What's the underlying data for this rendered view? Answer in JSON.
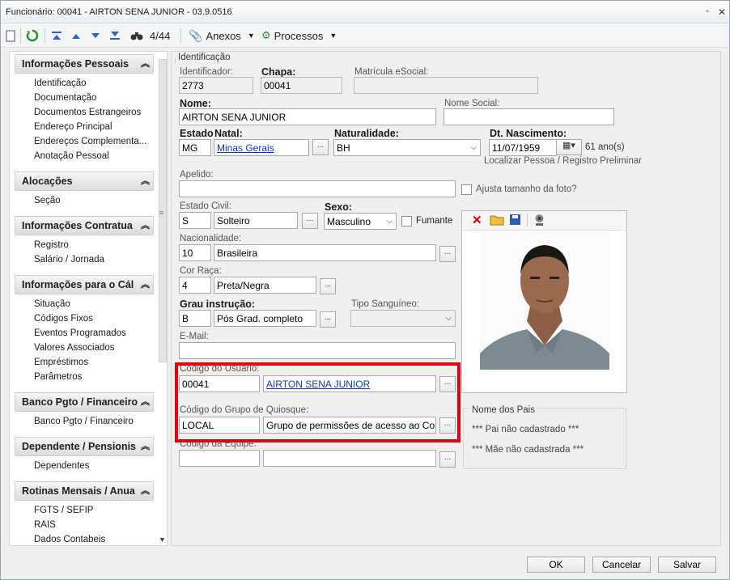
{
  "window": {
    "title": "Funcionário: 00041 - AIRTON SENA JUNIOR - 03.9.0516"
  },
  "toolbar": {
    "record": "4/44",
    "anexos": "Anexos",
    "processos": "Processos"
  },
  "sidebar": {
    "groups": [
      {
        "title": "Informações Pessoais",
        "items": [
          "Identificação",
          "Documentação",
          "Documentos Estrangeiros",
          "Endereço Principal",
          "Endereços Complementa...",
          "Anotação Pessoal"
        ]
      },
      {
        "title": "Alocações",
        "items": [
          "Seção"
        ]
      },
      {
        "title": "Informações Contratua",
        "items": [
          "Registro",
          "Salário / Jornada"
        ]
      },
      {
        "title": "Informações para o Cál",
        "items": [
          "Situação",
          "Códigos Fixos",
          "Eventos Programados",
          "Valores Associados",
          "Empréstimos",
          "Parâmetros"
        ]
      },
      {
        "title": "Banco Pgto / Financeiro",
        "items": [
          "Banco Pgto / Financeiro"
        ]
      },
      {
        "title": "Dependente / Pensionis",
        "items": [
          "Dependentes"
        ]
      },
      {
        "title": "Rotinas Mensais / Anua",
        "items": [
          "FGTS / SEFIP",
          "RAIS",
          "Dados Contabeis"
        ]
      }
    ]
  },
  "form": {
    "section": "Identificação",
    "identificador_label": "Identificador:",
    "identificador": "2773",
    "chapa_label": "Chapa:",
    "chapa": "00041",
    "matricula_label": "Matrícula eSocial:",
    "matricula": "",
    "nome_label": "Nome:",
    "nome": "AIRTON SENA JUNIOR",
    "nome_social_label": "Nome Social:",
    "nome_social": "",
    "estado_label": "Estado",
    "natal_label": "Natal:",
    "estado": "MG",
    "natal": "Minas Gerais",
    "naturalidade_label": "Naturalidade:",
    "naturalidade": "BH",
    "dt_nasc_label": "Dt. Nascimento:",
    "dt_nasc": "11/07/1959",
    "idade": "61 ano(s)",
    "localizar": "Localizar Pessoa / Registro Preliminar",
    "apelido_label": "Apelido:",
    "apelido": "",
    "ajusta_foto": "Ajusta tamanho da foto?",
    "estado_civil_label": "Estado Civil:",
    "estado_civil_cod": "S",
    "estado_civil": "Solteiro",
    "sexo_label": "Sexo:",
    "sexo": "Masculino",
    "fumante": "Fumante",
    "nacionalidade_label": "Nacionalidade:",
    "nacionalidade_cod": "10",
    "nacionalidade": "Brasileira",
    "cor_raca_label": "Cor Raça:",
    "cor_raca_cod": "4",
    "cor_raca": "Preta/Negra",
    "grau_label": "Grau instrução:",
    "grau_cod": "B",
    "grau": "Pós Grad. completo",
    "tipo_sangue_label": "Tipo Sanguíneo:",
    "tipo_sangue": "",
    "email_label": "E-Mail:",
    "email": "",
    "cod_usuario_label": "Código do Usuário:",
    "cod_usuario": "00041",
    "usuario_nome": "AIRTON SENA JUNIOR",
    "cod_grupo_label": "Código do Grupo de Quiosque:",
    "cod_grupo": "LOCAL",
    "grupo_desc": "Grupo de permissões de acesso ao Corporel",
    "cod_equipe_label": "Código da Equipe:",
    "cod_equipe": "",
    "equipe_desc": "",
    "pais_title": "Nome dos Pais",
    "pai": "*** Pai não cadastrado ***",
    "mae": "*** Mãe não cadastrada ***",
    "ellipsis": "..."
  },
  "buttons": {
    "ok": "OK",
    "cancelar": "Cancelar",
    "salvar": "Salvar"
  }
}
